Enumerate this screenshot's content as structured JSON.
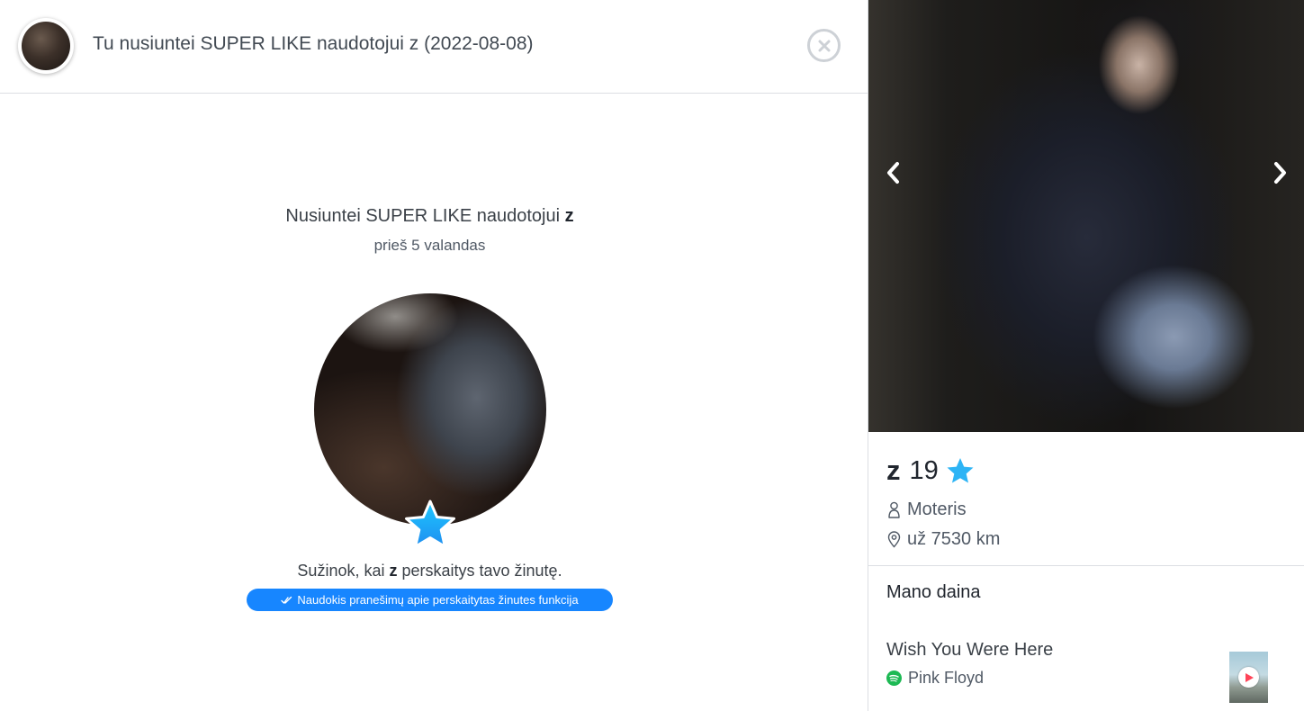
{
  "header": {
    "title": "Tu nusiuntei SUPER LIKE naudotojui z (2022-08-08)"
  },
  "superlike": {
    "prefix": "Nusiuntei SUPER LIKE naudotojui ",
    "name": "z",
    "time_ago": "prieš 5 valandas",
    "read_prefix": "Sužinok, kai ",
    "read_name": "z",
    "read_suffix": " perskaitys tavo žinutę.",
    "read_receipts_button": "Naudokis pranešimų apie perskaitytas žinutes funkcija"
  },
  "profile": {
    "name": "z",
    "age": "19",
    "gender": "Moteris",
    "distance": "už 7530 km",
    "anthem_label": "Mano daina",
    "song_title": "Wish You Were Here",
    "artist": "Pink Floyd"
  },
  "colors": {
    "accent_blue": "#1786ff",
    "superlike_star": "#2db4f5",
    "spotify_green": "#1db954"
  },
  "icons": {
    "close": "close-circle-icon",
    "superlike": "star-icon",
    "read": "double-check-icon",
    "gender": "person-icon",
    "distance": "location-pin-icon",
    "prev_photo": "chevron-left-icon",
    "next_photo": "chevron-right-icon",
    "spotify": "spotify-icon",
    "play": "play-icon"
  }
}
